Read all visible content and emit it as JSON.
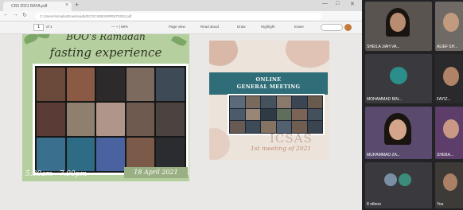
{
  "browser": {
    "tab_title": "CR3 2021 RAYA.pdf",
    "tab_close": "×",
    "new_tab": "+",
    "url": "C:/Users/ismailia/Downloads/ECOCS0ES0RRNT0202.pdf",
    "nav_back": "←",
    "nav_forward": "→",
    "nav_refresh": "↻",
    "win_min": "—",
    "win_max": "□",
    "win_close": "✕"
  },
  "pdf_toolbar": {
    "page": "1",
    "page_total": "of 1",
    "zoom": "— + | 68%",
    "tools": [
      "Page view",
      "Read aloud",
      "Draw",
      "Highlight",
      "Erase"
    ]
  },
  "slide1": {
    "title_line1": "BOO's Ramadan",
    "title_line2": "fasting experience",
    "time": "5.30am - 7.00pm",
    "date": "18 April 2021"
  },
  "slide2": {
    "title_line1": "ONLINE",
    "title_line2": "GENERAL MEETING",
    "brand": "ICSAS",
    "subtitle": "1st meeting of 2021"
  },
  "participants": [
    {
      "name": "SHEILA JIAH VA...",
      "avatar": "photo-woman"
    },
    {
      "name": "ALIEF SH...",
      "avatar": "photo-man"
    },
    {
      "name": "MOHAMMAD BIN...",
      "avatar": "teal-avatar"
    },
    {
      "name": "FAYIZ...",
      "avatar": "photo-man"
    },
    {
      "name": "MUHAMMAD ZA...",
      "avatar": "photo-woman"
    },
    {
      "name": "SHEBA...",
      "avatar": "photo-woman"
    },
    {
      "name": "8 others",
      "avatar": "group-avatar"
    },
    {
      "name": "You",
      "avatar": "photo-man"
    }
  ],
  "colors": {
    "slide1_bg": "#b6cf9f",
    "slide2_bg": "#ece3db",
    "slide2_banner": "#2f6e78",
    "panel_bg": "#232326"
  }
}
